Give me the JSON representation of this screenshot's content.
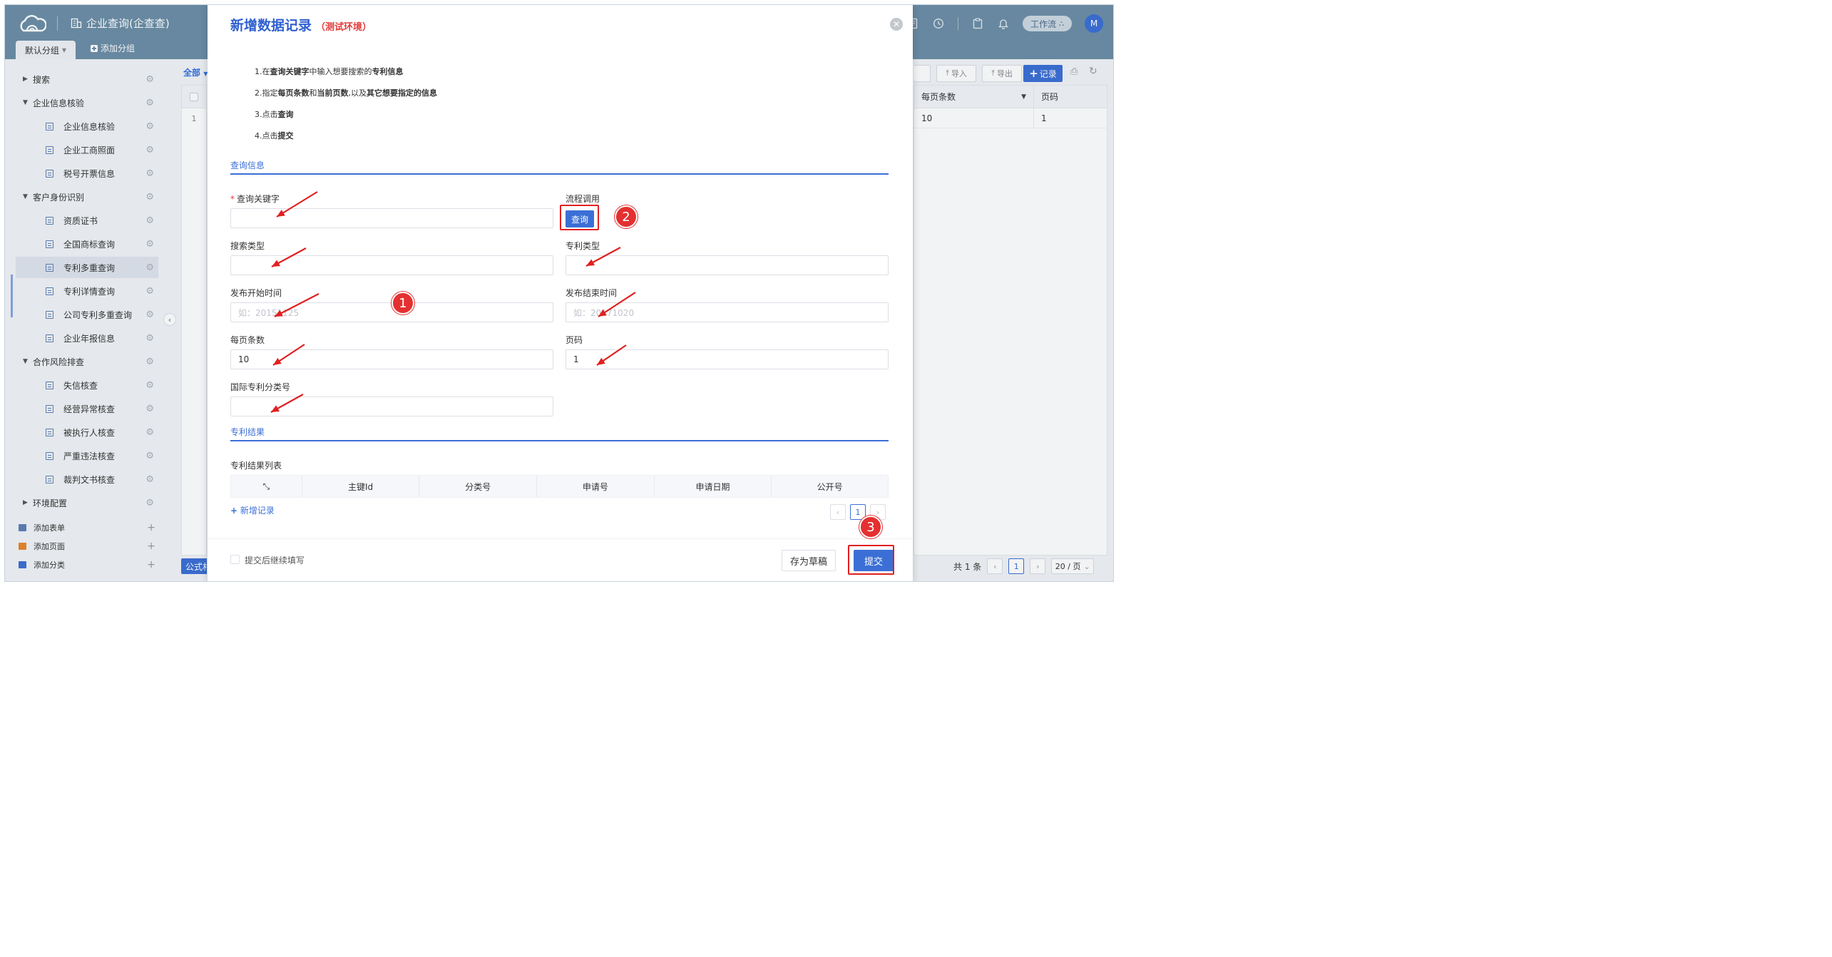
{
  "app": {
    "title": "企业查询(企查查)",
    "avatar": "M",
    "workflow": "工作流"
  },
  "tabs": {
    "default_group": "默认分组",
    "add_group": "添加分组"
  },
  "sidebar": {
    "items": [
      {
        "label": "搜索",
        "level": 0,
        "caret": "▶"
      },
      {
        "label": "企业信息核验",
        "level": 0,
        "caret": "▼"
      },
      {
        "label": "企业信息核验",
        "level": 1
      },
      {
        "label": "企业工商照面",
        "level": 1
      },
      {
        "label": "税号开票信息",
        "level": 1
      },
      {
        "label": "客户身份识别",
        "level": 0,
        "caret": "▼"
      },
      {
        "label": "资质证书",
        "level": 1
      },
      {
        "label": "全国商标查询",
        "level": 1
      },
      {
        "label": "专利多重查询",
        "level": 1,
        "active": true
      },
      {
        "label": "专利详情查询",
        "level": 1
      },
      {
        "label": "公司专利多重查询",
        "level": 1
      },
      {
        "label": "企业年报信息",
        "level": 1
      },
      {
        "label": "合作风险排查",
        "level": 0,
        "caret": "▼"
      },
      {
        "label": "失信核查",
        "level": 1
      },
      {
        "label": "经营异常核查",
        "level": 1
      },
      {
        "label": "被执行人核查",
        "level": 1
      },
      {
        "label": "严重违法核查",
        "level": 1
      },
      {
        "label": "裁判文书核查",
        "level": 1
      },
      {
        "label": "环境配置",
        "level": 0,
        "caret": "▶"
      }
    ],
    "bottom": [
      {
        "label": "添加表单",
        "icon": "form-icon"
      },
      {
        "label": "添加页面",
        "icon": "page-icon"
      },
      {
        "label": "添加分类",
        "icon": "folder-icon"
      }
    ]
  },
  "content": {
    "filter_tab": "全部",
    "row_number": "1",
    "formula_btn": "公式村",
    "toolbar": {
      "import": "导入",
      "export": "导出",
      "add_record": "记录"
    },
    "table": {
      "headers": [
        "每页条数",
        "页码"
      ],
      "rows": [
        [
          "10",
          "1"
        ]
      ]
    },
    "pager": {
      "total": "共 1 条",
      "current": "1",
      "page_size": "20 / 页"
    }
  },
  "modal": {
    "title": "新增数据记录",
    "env": "（测试环境）",
    "instructions": [
      {
        "n": "1.",
        "parts": [
          [
            "在",
            false
          ],
          [
            "查询关键字",
            true
          ],
          [
            "中输入想要搜索的",
            false
          ],
          [
            "专利信息",
            true
          ]
        ]
      },
      {
        "n": "2.",
        "parts": [
          [
            "指定",
            false
          ],
          [
            "每页条数",
            true
          ],
          [
            "和",
            false
          ],
          [
            "当前页数",
            true
          ],
          [
            ",以及",
            false
          ],
          [
            "其它想要指定的信息",
            true
          ]
        ]
      },
      {
        "n": "3.",
        "parts": [
          [
            "点击",
            false
          ],
          [
            "查询",
            true
          ]
        ]
      },
      {
        "n": "4.",
        "parts": [
          [
            "点击",
            false
          ],
          [
            "提交",
            true
          ]
        ]
      }
    ],
    "section_query": "查询信息",
    "fields": {
      "keyword": {
        "label": "查询关键字",
        "value": ""
      },
      "flow": {
        "label": "流程调用",
        "button": "查询"
      },
      "search_type": {
        "label": "搜索类型",
        "value": ""
      },
      "patent_type": {
        "label": "专利类型",
        "value": ""
      },
      "start_time": {
        "label": "发布开始时间",
        "placeholder": "如：20151125"
      },
      "end_time": {
        "label": "发布结束时间",
        "placeholder": "如：20171020"
      },
      "page_size": {
        "label": "每页条数",
        "value": "10"
      },
      "page_no": {
        "label": "页码",
        "value": "1"
      },
      "ipc": {
        "label": "国际专利分类号",
        "value": ""
      }
    },
    "section_result": "专利结果",
    "result_list_label": "专利结果列表",
    "result_columns": [
      "主键Id",
      "分类号",
      "申请号",
      "申请日期",
      "公开号"
    ],
    "add_record": "新增记录",
    "result_page": "1",
    "continue_label": "提交后继续填写",
    "draft_btn": "存为草稿",
    "submit_btn": "提交",
    "badges": [
      "1",
      "2",
      "3"
    ]
  },
  "colors": {
    "primary": "#3b6fd6",
    "header": "#6c8ea6",
    "annotation": "#e02020"
  }
}
